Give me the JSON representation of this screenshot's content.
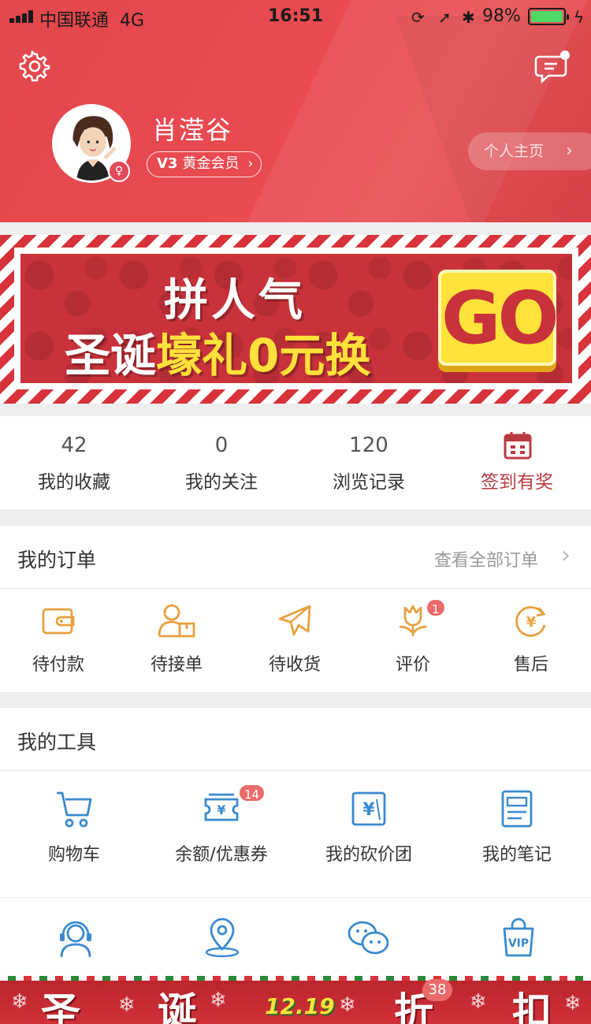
{
  "status_bar": {
    "carrier": "中国联通",
    "network": "4G",
    "time": "16:51",
    "battery_percent": "98%"
  },
  "profile": {
    "username": "肖滢谷",
    "level": "V3",
    "membership": "黄金会员",
    "homepage_label": "个人主页"
  },
  "banner": {
    "line1": "拼人气",
    "line2_white": "圣诞",
    "line2_yellow": "壕礼0元换",
    "go_label": "GO"
  },
  "stats": [
    {
      "value": "42",
      "label": "我的收藏"
    },
    {
      "value": "0",
      "label": "我的关注"
    },
    {
      "value": "120",
      "label": "浏览记录"
    },
    {
      "label": "签到有奖"
    }
  ],
  "orders": {
    "title": "我的订单",
    "view_all": "查看全部订单",
    "items": [
      {
        "label": "待付款",
        "icon": "wallet-icon"
      },
      {
        "label": "待接单",
        "icon": "person-box-icon"
      },
      {
        "label": "待收货",
        "icon": "plane-icon"
      },
      {
        "label": "评价",
        "icon": "flower-icon",
        "badge": "1"
      },
      {
        "label": "售后",
        "icon": "yen-refresh-icon"
      }
    ]
  },
  "tools": {
    "title": "我的工具",
    "items": [
      {
        "label": "购物车",
        "icon": "cart-icon"
      },
      {
        "label": "余额/优惠券",
        "icon": "coupon-icon",
        "badge": "14"
      },
      {
        "label": "我的砍价团",
        "icon": "yen-tag-icon"
      },
      {
        "label": "我的笔记",
        "icon": "notebook-icon"
      }
    ],
    "row2_icons": [
      "support-icon",
      "location-icon",
      "wechat-icon",
      "vip-bag-icon"
    ],
    "vip_text": "VIP"
  },
  "festive_strip": {
    "chars": [
      "圣",
      "诞",
      "折",
      "扣"
    ],
    "date": "12.19",
    "badge": "38"
  },
  "colors": {
    "header_red": "#e84a50",
    "order_icon_orange": "#e8a040",
    "tool_icon_blue": "#3a8ad0",
    "badge_red": "#ea6a6a",
    "checkin_red": "#b83b40"
  }
}
